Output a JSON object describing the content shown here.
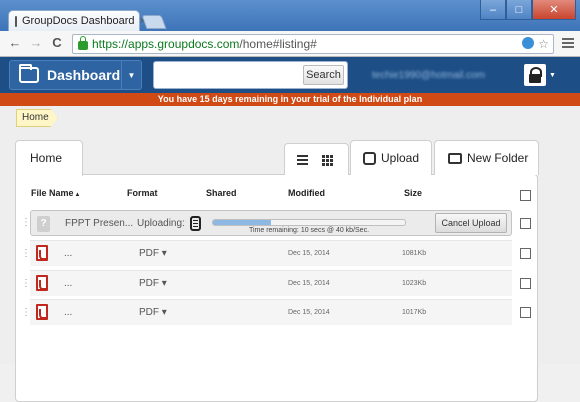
{
  "browser": {
    "tab_title": "GroupDocs Dashboard",
    "tab_close": "×",
    "url_host": "https://apps.groupdocs.com",
    "url_path": "/home#listing#",
    "nav_back": "←",
    "nav_forward": "→",
    "nav_reload": "C",
    "star_icon": "☆"
  },
  "header": {
    "dashboard_label": "Dashboard",
    "search_placeholder": "",
    "search_button": "Search",
    "user_email": "techie1990@hotmail.com"
  },
  "trial_banner": "You have 15 days remaining in your trial of the Individual plan",
  "breadcrumb": "Home",
  "tabs": {
    "home": "Home"
  },
  "actions": {
    "upload": "Upload",
    "new_folder": "New Folder"
  },
  "columns": {
    "file_name": "File Name",
    "format": "Format",
    "shared": "Shared",
    "modified": "Modified",
    "size": "Size"
  },
  "uploading_row": {
    "file_icon": "?",
    "name": "FPPT Presen...",
    "status": "Uploading:",
    "progress": 0.3,
    "time_remaining": "Time remaining: 10 secs @ 40 kb/Sec.",
    "cancel_label": "Cancel Upload"
  },
  "files": [
    {
      "name": "...",
      "format": "PDF ▾",
      "modified": "Dec 15, 2014",
      "size": "1081Kb"
    },
    {
      "name": "...",
      "format": "PDF ▾",
      "modified": "Dec 15, 2014",
      "size": "1023Kb"
    },
    {
      "name": "...",
      "format": "PDF ▾",
      "modified": "Dec 15, 2014",
      "size": "1017Kb"
    }
  ]
}
